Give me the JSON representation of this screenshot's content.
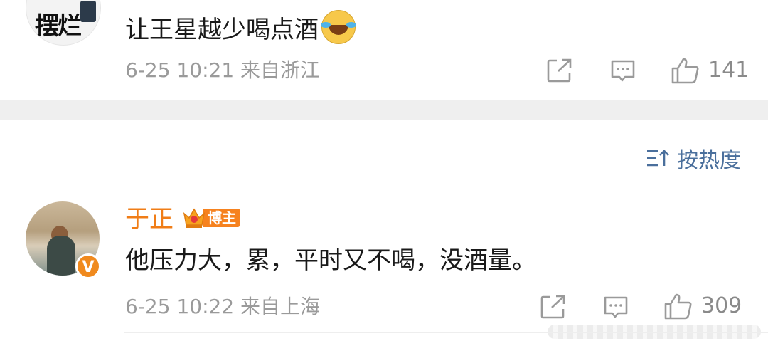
{
  "comment1": {
    "avatar_text": "摆烂",
    "text": "让王星越少喝点酒",
    "emoji": "laugh-cry-emoji",
    "time": "6-25 10:21",
    "source": "来自浙江",
    "likes": "141"
  },
  "sort": {
    "label": "按热度",
    "icon": "sort-icon"
  },
  "comment2": {
    "username": "于正",
    "badge": "博主",
    "verified_mark": "V",
    "text": "他压力大，累，平时又不喝，没酒量。",
    "time": "6-25 10:22",
    "source": "来自上海",
    "likes": "309"
  },
  "colors": {
    "accent_orange": "#f07d17",
    "link_blue": "#4a6f9c",
    "meta_gray": "#9a9a9a",
    "divider": "#efefef"
  }
}
